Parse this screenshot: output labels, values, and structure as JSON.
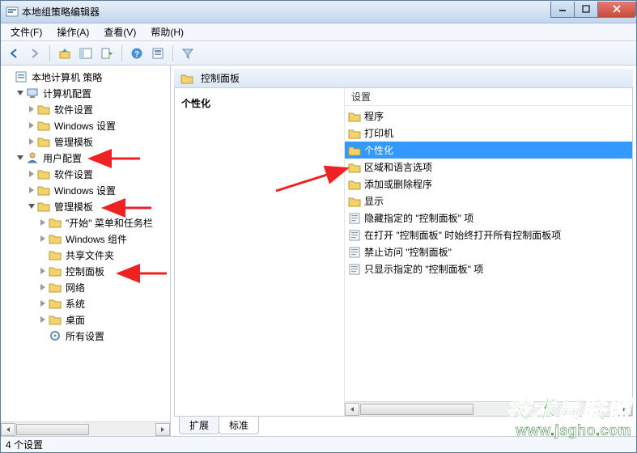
{
  "window": {
    "title": "本地组策略编辑器"
  },
  "menubar": {
    "file": "文件(F)",
    "action": "操作(A)",
    "view": "查看(V)",
    "help": "帮助(H)"
  },
  "tree": {
    "root": "本地计算机 策略",
    "computer_config": "计算机配置",
    "cc_software": "软件设置",
    "cc_windows": "Windows 设置",
    "cc_admin": "管理模板",
    "user_config": "用户配置",
    "uc_software": "软件设置",
    "uc_windows": "Windows 设置",
    "uc_admin": "管理模板",
    "ua_start_taskbar": "\"开始\" 菜单和任务栏",
    "ua_windows_comp": "Windows 组件",
    "ua_shared_folders": "共享文件夹",
    "ua_control_panel": "控制面板",
    "ua_network": "网络",
    "ua_system": "系统",
    "ua_desktop": "桌面",
    "ua_all_settings": "所有设置"
  },
  "path_header": "控制面板",
  "detail_heading": "个性化",
  "list_header": "设置",
  "list_items": [
    {
      "type": "folder",
      "label": "程序"
    },
    {
      "type": "folder",
      "label": "打印机"
    },
    {
      "type": "folder",
      "label": "个性化",
      "selected": true
    },
    {
      "type": "folder",
      "label": "区域和语言选项"
    },
    {
      "type": "folder",
      "label": "添加或删除程序"
    },
    {
      "type": "folder",
      "label": "显示"
    },
    {
      "type": "setting",
      "label": "隐藏指定的 \"控制面板\" 项"
    },
    {
      "type": "setting",
      "label": "在打开 \"控制面板\" 时始终打开所有控制面板项"
    },
    {
      "type": "setting",
      "label": "禁止访问 \"控制面板\""
    },
    {
      "type": "setting",
      "label": "只显示指定的 \"控制面板\" 项"
    }
  ],
  "bottom_tabs": {
    "extended": "扩展",
    "standard": "标准"
  },
  "statusbar": "4 个设置",
  "watermark": {
    "line1": "技术员联盟",
    "line2_pre": "www",
    "line2_mid": "jsgho",
    "line2_suf": "com"
  }
}
